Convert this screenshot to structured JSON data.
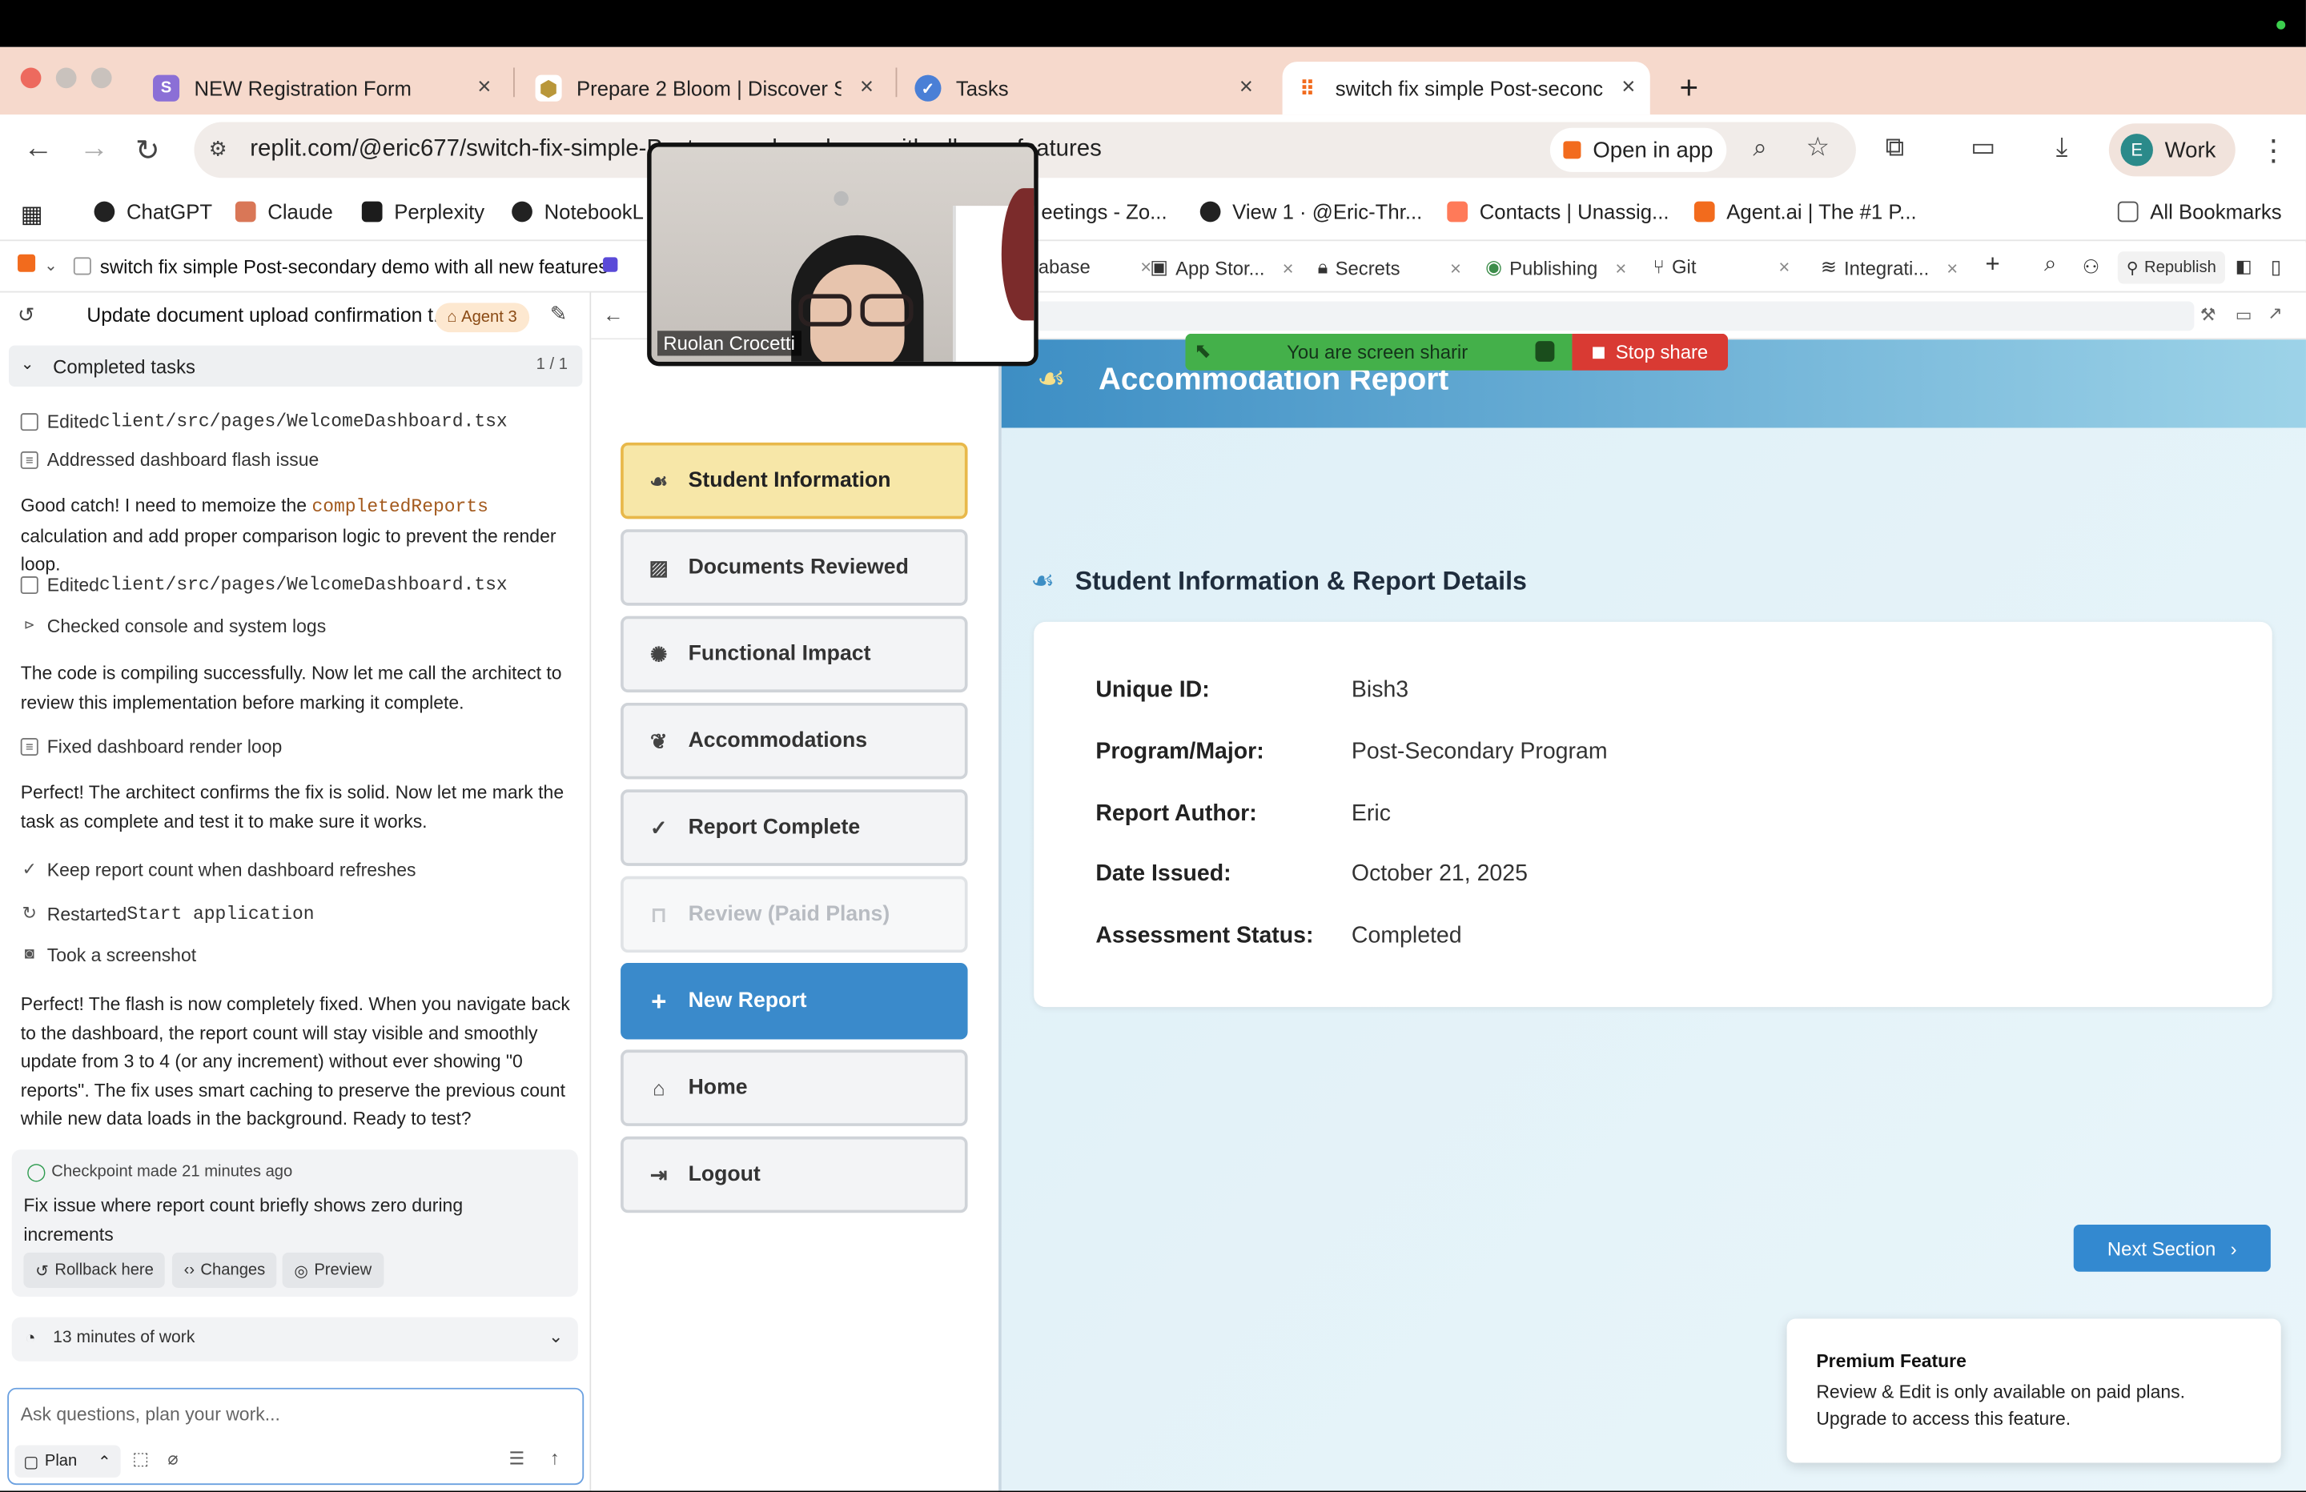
{
  "browser": {
    "tabs": [
      {
        "label": "NEW Registration Form",
        "fav": "S",
        "color": "#8b6fd6"
      },
      {
        "label": "Prepare 2 Bloom | Discover Su",
        "fav": "⬢",
        "color": "#b9973a"
      },
      {
        "label": "Tasks",
        "fav": "✓",
        "color": "#4a7fd6"
      },
      {
        "label": "switch fix simple Post-seconc",
        "fav": "⠿",
        "color": "#f26b1d"
      }
    ],
    "url": "replit.com/@eric677/switch-fix-simple-Post-secondary-demo-with-all-new-features",
    "open_in_app": "Open in app",
    "profile_initial": "E",
    "profile_label": "Work",
    "bookmarks": [
      {
        "label": "ChatGPT",
        "color": "#222"
      },
      {
        "label": "Claude",
        "color": "#d97757"
      },
      {
        "label": "Perplexity",
        "color": "#1c1c1c"
      },
      {
        "label": "NotebookL",
        "color": "#222"
      },
      {
        "label": "eetings - Zo...",
        "color": "#2d8cff"
      },
      {
        "label": "View 1 · @Eric-Thr...",
        "color": "#222"
      },
      {
        "label": "Contacts | Unassig...",
        "color": "#ff7a59"
      },
      {
        "label": "Agent.ai | The #1 P...",
        "color": "#f26b1d"
      }
    ],
    "all_bookmarks": "All Bookmarks"
  },
  "replit": {
    "project_title": "switch fix simple Post-secondary demo with all new features",
    "tabs": [
      {
        "label": "abase"
      },
      {
        "label": "App Stor..."
      },
      {
        "label": "Secrets"
      },
      {
        "label": "Publishing"
      },
      {
        "label": "Git"
      },
      {
        "label": "Integrati..."
      }
    ],
    "republish": "Republish"
  },
  "agent": {
    "thread_title": "Update document upload confirmation t...",
    "badge": "Agent 3",
    "completed_label": "Completed tasks",
    "completed_count": "1 / 1",
    "logs": [
      {
        "text": "Edited ",
        "code": "client/src/pages/WelcomeDashboard.tsx"
      },
      {
        "text": "Addressed dashboard flash issue",
        "code": ""
      },
      {
        "text": "Edited ",
        "code": "client/src/pages/WelcomeDashboard.tsx"
      },
      {
        "text": "Checked console and system logs",
        "code": ""
      },
      {
        "text": "Fixed dashboard render loop",
        "code": ""
      },
      {
        "text": "Keep report count when dashboard refreshes",
        "code": ""
      },
      {
        "text": "Restarted ",
        "code": "Start application"
      },
      {
        "text": "Took a screenshot",
        "code": ""
      }
    ],
    "msg1_a": "Good catch! I need to memoize the ",
    "msg1_code": "completedReports",
    "msg1_b": " calculation and add proper comparison logic to prevent the render loop.",
    "msg2": "The code is compiling successfully. Now let me call the architect to review this implementation before marking it complete.",
    "msg3": "Perfect! The architect confirms the fix is solid. Now let me mark the task as complete and test it to make sure it works.",
    "msg4": "Perfect! The flash is now completely fixed. When you navigate back to the dashboard, the report count will stay visible and smoothly update from 3 to 4 (or any increment) without ever showing \"0 reports\". The fix uses smart caching to preserve the previous count while new data loads in the background. Ready to test?",
    "checkpoint_time": "Checkpoint made 21 minutes ago",
    "checkpoint_desc": "Fix issue where report count briefly shows zero during increments",
    "btn_rollback": "Rollback here",
    "btn_changes": "Changes",
    "btn_preview": "Preview",
    "work_time": "13 minutes of work",
    "input_placeholder": "Ask questions, plan your work...",
    "plan_label": "Plan"
  },
  "app": {
    "header_title": "Accommodation Report",
    "nav": [
      {
        "label": "Student Information",
        "state": "active"
      },
      {
        "label": "Documents Reviewed",
        "state": "normal"
      },
      {
        "label": "Functional Impact",
        "state": "normal"
      },
      {
        "label": "Accommodations",
        "state": "normal"
      },
      {
        "label": "Report Complete",
        "state": "normal"
      },
      {
        "label": "Review (Paid Plans)",
        "state": "disabled"
      },
      {
        "label": "New Report",
        "state": "primary"
      },
      {
        "label": "Home",
        "state": "normal"
      },
      {
        "label": "Logout",
        "state": "normal"
      }
    ],
    "section_title": "Student Information & Report Details",
    "details": [
      {
        "label": "Unique ID:",
        "value": "Bish3"
      },
      {
        "label": "Program/Major:",
        "value": "Post-Secondary Program"
      },
      {
        "label": "Report Author:",
        "value": "Eric"
      },
      {
        "label": "Date Issued:",
        "value": "October 21, 2025"
      },
      {
        "label": "Assessment Status:",
        "value": "Completed"
      }
    ],
    "next_button": "Next Section",
    "premium_title": "Premium Feature",
    "premium_text": "Review & Edit is only available on paid plans. Upgrade to access this feature."
  },
  "screen_share": {
    "status": "You are screen sharir",
    "stop": "Stop share",
    "participant": "Ruolan Crocetti"
  },
  "colors": {
    "accent": "#3389d0",
    "active_nav": "#f7e7a8",
    "share_green": "#44b04a",
    "share_red": "#d93a33"
  }
}
